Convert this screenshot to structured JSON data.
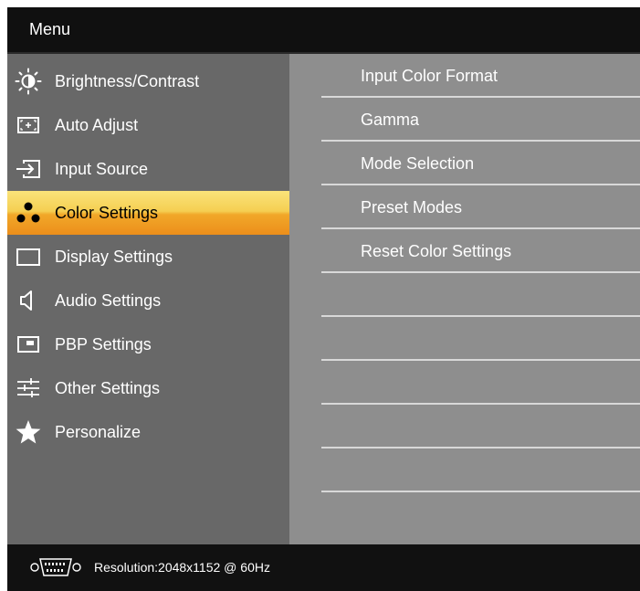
{
  "menu": {
    "title": "Menu"
  },
  "sidebar": {
    "items": [
      {
        "label": "Brightness/Contrast",
        "icon": "brightness-icon"
      },
      {
        "label": "Auto Adjust",
        "icon": "auto-adjust-icon"
      },
      {
        "label": "Input Source",
        "icon": "input-source-icon"
      },
      {
        "label": "Color Settings",
        "icon": "color-settings-icon",
        "selected": true
      },
      {
        "label": "Display Settings",
        "icon": "display-icon"
      },
      {
        "label": "Audio Settings",
        "icon": "speaker-icon"
      },
      {
        "label": "PBP Settings",
        "icon": "pbp-icon"
      },
      {
        "label": "Other Settings",
        "icon": "sliders-icon"
      },
      {
        "label": "Personalize",
        "icon": "star-icon"
      }
    ]
  },
  "submenu": {
    "items": [
      {
        "label": "Input Color Format"
      },
      {
        "label": "Gamma"
      },
      {
        "label": "Mode Selection"
      },
      {
        "label": "Preset Modes"
      },
      {
        "label": "Reset Color Settings"
      },
      {
        "label": ""
      },
      {
        "label": ""
      },
      {
        "label": ""
      },
      {
        "label": ""
      },
      {
        "label": ""
      }
    ]
  },
  "footer": {
    "status": "Resolution:2048x1152 @ 60Hz",
    "connector_icon": "vga-connector-icon"
  },
  "colors": {
    "selected_top": "#fae37a",
    "selected_bottom": "#ec8e1b",
    "sidebar_bg": "#686868",
    "content_bg": "#8e8e8e"
  }
}
